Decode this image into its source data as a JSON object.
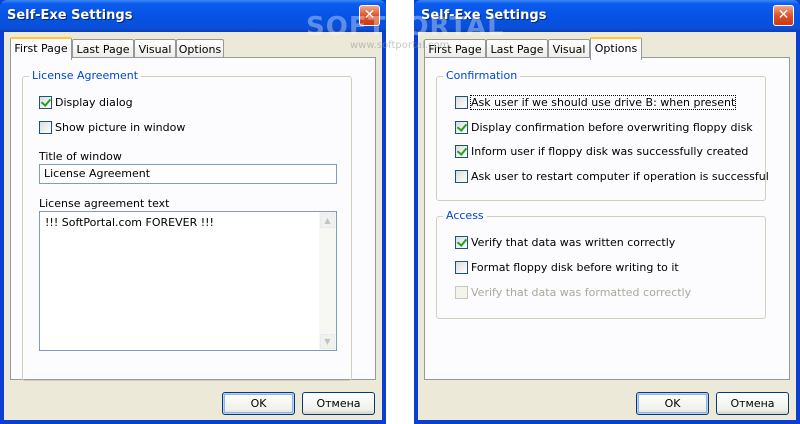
{
  "window_title": "Self-Exe Settings",
  "close_glyph": "✕",
  "left": {
    "tabs": [
      "First Page",
      "Last Page",
      "Visual",
      "Options"
    ],
    "group_title": "License Agreement",
    "display_dialog": "Display dialog",
    "show_picture": "Show picture in window",
    "title_label": "Title of window",
    "title_value": "License Agreement",
    "text_label": "License agreement text",
    "text_value": "!!! SoftPortal.com FOREVER !!!"
  },
  "right": {
    "tabs": [
      "First Page",
      "Last Page",
      "Visual",
      "Options"
    ],
    "confirmation_title": "Confirmation",
    "confirmation": [
      {
        "label": "Ask user if we should use drive B: when present",
        "checked": false
      },
      {
        "label": "Display confirmation before overwriting floppy disk",
        "checked": true
      },
      {
        "label": "Inform user if floppy disk was successfully created",
        "checked": true
      },
      {
        "label": "Ask user to restart computer if operation is successful",
        "checked": false
      }
    ],
    "access_title": "Access",
    "access": [
      {
        "label": "Verify that data was written correctly",
        "checked": true
      },
      {
        "label": "Format floppy disk before writing to it",
        "checked": false
      },
      {
        "label": "Verify that data was formatted correctly",
        "checked": false,
        "disabled": true
      }
    ]
  },
  "buttons": {
    "ok": "OK",
    "cancel": "Отмена"
  },
  "watermark": {
    "big": "SOFTPORTAL",
    "small": "www.softportal.com"
  }
}
